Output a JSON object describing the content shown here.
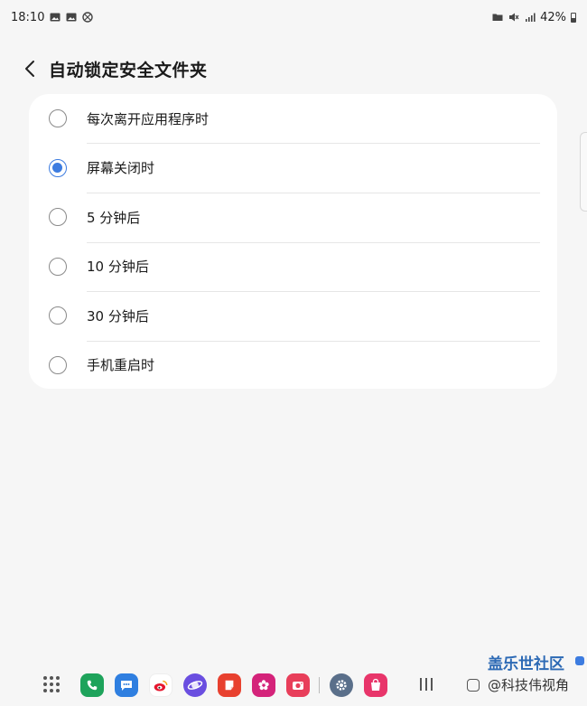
{
  "status_bar": {
    "time": "18:10",
    "battery": "42%",
    "left_icons": [
      "gallery-icon",
      "gallery-icon",
      "no-disturb-icon"
    ],
    "right_icons": [
      "folder-icon",
      "mute-icon",
      "signal-icon",
      "battery-icon"
    ]
  },
  "header": {
    "title": "自动锁定安全文件夹",
    "back_icon": "chevron-left-icon"
  },
  "options": [
    {
      "label": "每次离开应用程序时",
      "selected": false
    },
    {
      "label": "屏幕关闭时",
      "selected": true
    },
    {
      "label": "5 分钟后",
      "selected": false
    },
    {
      "label": "10 分钟后",
      "selected": false
    },
    {
      "label": "30 分钟后",
      "selected": false
    },
    {
      "label": "手机重启时",
      "selected": false
    }
  ],
  "colors": {
    "accent": "#3d7ce0",
    "background": "#f6f6f6",
    "card": "#ffffff"
  },
  "taskbar": {
    "apps": [
      {
        "name": "phone-app",
        "color": "#1ea35b",
        "glyph": "✆"
      },
      {
        "name": "messages-app",
        "color": "#2f7fe0",
        "glyph": "…"
      },
      {
        "name": "weibo-app",
        "color": "#f5a623",
        "glyph": "◉"
      },
      {
        "name": "internet-app",
        "color": "#6a4ee0",
        "glyph": "◐"
      },
      {
        "name": "notes-app",
        "color": "#e8412f",
        "glyph": "▤"
      },
      {
        "name": "flower-app",
        "color": "#d4237a",
        "glyph": "✿"
      },
      {
        "name": "camera-app",
        "color": "#e83e5a",
        "glyph": "◎"
      },
      {
        "name": "settings-app",
        "color": "#5a6f8a",
        "glyph": "⚙"
      },
      {
        "name": "store-app",
        "color": "#e8356a",
        "glyph": "◫"
      }
    ]
  },
  "watermark": {
    "line1": "盖乐世社区",
    "line2": "@科技伟视角"
  }
}
